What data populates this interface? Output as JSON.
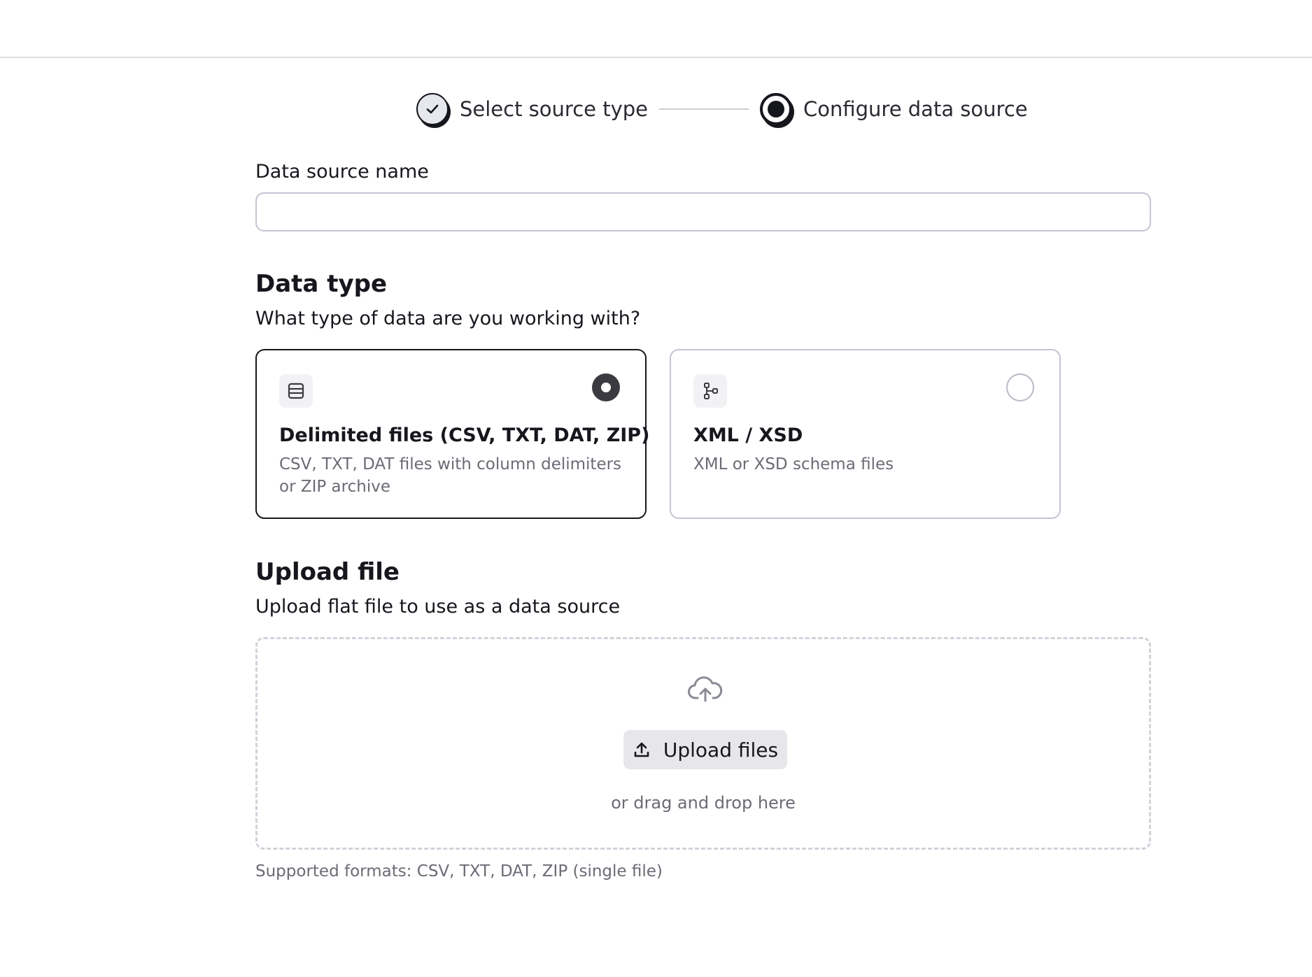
{
  "stepper": {
    "steps": [
      {
        "label": "Select source type",
        "state": "completed"
      },
      {
        "label": "Configure data source",
        "state": "active"
      }
    ]
  },
  "name_field": {
    "label": "Data source name",
    "value": "",
    "placeholder": ""
  },
  "data_type": {
    "title": "Data type",
    "subtitle": "What type of data are you working with?",
    "options": [
      {
        "title": "Delimited files (CSV, TXT, DAT, ZIP)",
        "description": "CSV, TXT, DAT files with column delimiters or ZIP archive",
        "icon": "table-icon",
        "selected": true
      },
      {
        "title": "XML / XSD",
        "description": "XML or XSD schema files",
        "icon": "hierarchy-icon",
        "selected": false
      }
    ]
  },
  "upload": {
    "title": "Upload file",
    "subtitle": "Upload flat file to use as a data source",
    "button_label": "Upload files",
    "drag_text": "or drag and drop here",
    "formats_note": "Supported formats: CSV, TXT, DAT, ZIP (single file)",
    "icon": "cloud-upload-icon",
    "button_icon": "upload-icon"
  },
  "colors": {
    "text_primary": "#16161d",
    "text_muted": "#6b6b75",
    "border": "#c5c5d2",
    "selected_border": "#16161d",
    "button_bg": "#e7e7eb"
  }
}
